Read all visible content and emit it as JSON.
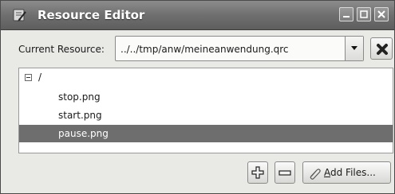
{
  "window": {
    "title": "Resource Editor"
  },
  "resource": {
    "label": "Current Resource:",
    "value": "../../tmp/anw/meineanwendung.qrc"
  },
  "tree": {
    "root": "/",
    "items": [
      {
        "label": "stop.png",
        "selected": false
      },
      {
        "label": "start.png",
        "selected": false
      },
      {
        "label": "pause.png",
        "selected": true
      }
    ]
  },
  "buttons": {
    "add_files_mnemonic": "A",
    "add_files_rest": "dd Files..."
  },
  "colors": {
    "titlebar": "#6f6f6f",
    "selection": "#6e6e6e",
    "window_bg": "#e9e9e6"
  },
  "icons": {
    "app": "resource-editor-icon",
    "combo": "chevron-down-icon",
    "remove": "remove-x-icon",
    "add": "plus-icon",
    "minus": "minus-icon",
    "add_files": "paperclip-icon"
  }
}
